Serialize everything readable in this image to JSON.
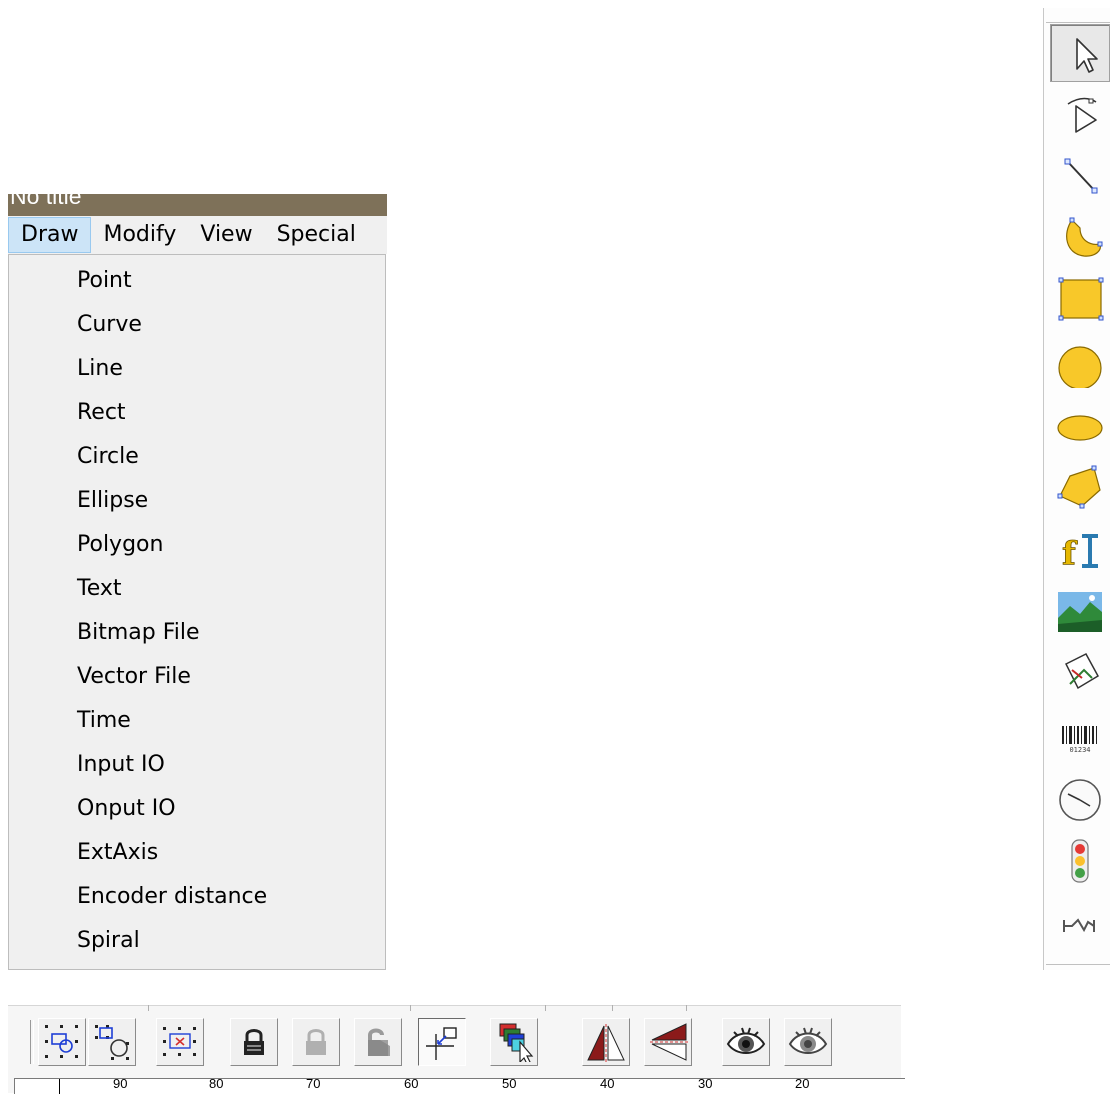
{
  "window": {
    "title": "No title"
  },
  "menubar": [
    {
      "label": "Draw",
      "active": true
    },
    {
      "label": "Modify"
    },
    {
      "label": "View"
    },
    {
      "label": "Special"
    }
  ],
  "draw_menu": {
    "items": [
      "Point",
      "Curve",
      "Line",
      "Rect",
      "Circle",
      "Ellipse",
      "Polygon",
      "Text",
      "Bitmap File",
      "Vector File",
      "Time",
      "Input IO",
      "Onput IO",
      "ExtAxis",
      "Encoder distance",
      "Spiral"
    ]
  },
  "right_toolbar": {
    "tools": [
      {
        "icon": "arrow-select-icon"
      },
      {
        "icon": "node-edit-icon"
      },
      {
        "icon": "line-tool-icon"
      },
      {
        "icon": "curve-tool-icon"
      },
      {
        "icon": "rect-tool-icon"
      },
      {
        "icon": "circle-tool-icon"
      },
      {
        "icon": "ellipse-tool-icon"
      },
      {
        "icon": "polygon-tool-icon"
      },
      {
        "icon": "text-tool-icon"
      },
      {
        "icon": "bitmap-tool-icon"
      },
      {
        "icon": "vector-file-tool-icon"
      },
      {
        "icon": "barcode-tool-icon",
        "label": "01234"
      },
      {
        "icon": "clock-tool-icon"
      },
      {
        "icon": "io-signal-tool-icon"
      },
      {
        "icon": "ext-axis-tool-icon"
      }
    ]
  },
  "bottom_toolbar": {
    "buttons": [
      "group-icon",
      "ungroup-icon",
      "delete-group-icon",
      "lock-icon",
      "unlock-icon",
      "unlock-all-icon",
      "origin-icon",
      "layer-order-icon",
      "mirror-horizontal-icon",
      "mirror-vertical-icon",
      "show-icon",
      "hide-icon"
    ]
  },
  "ruler": {
    "labels": [
      "90",
      "80",
      "70",
      "60",
      "50",
      "40",
      "30",
      "20"
    ]
  },
  "colors": {
    "title_bar": "#7e7159",
    "menu_bg": "#f0f0f0",
    "menu_active": "#cce4f7",
    "shape_yellow": "#f8c829"
  }
}
